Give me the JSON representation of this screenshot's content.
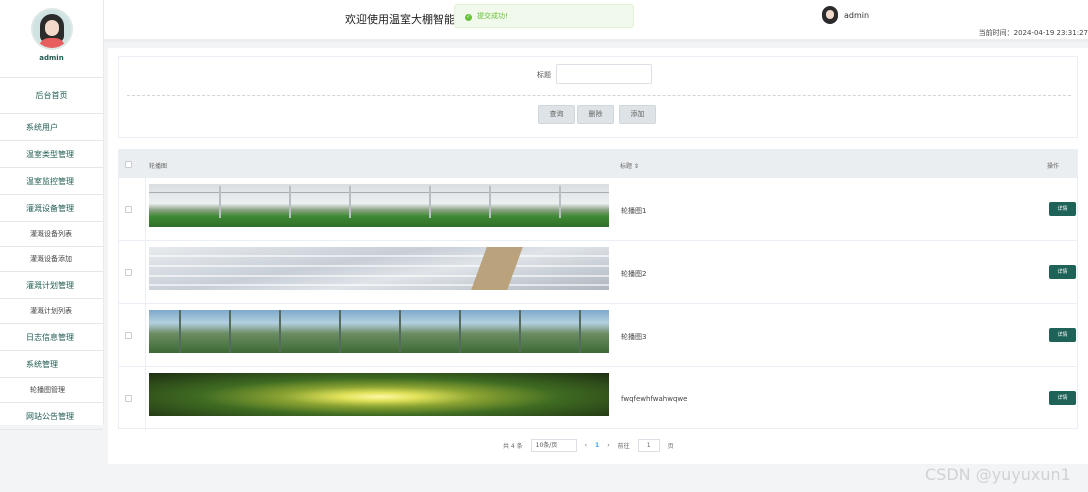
{
  "sidebar": {
    "user_name": "admin",
    "menu": [
      {
        "label": "后台首页",
        "type": "main"
      },
      {
        "label": "系统用户",
        "type": "group"
      },
      {
        "label": "温室类型管理",
        "type": "group"
      },
      {
        "label": "温室监控管理",
        "type": "group"
      },
      {
        "label": "灌溉设备管理",
        "type": "group"
      },
      {
        "label": "灌溉设备列表",
        "type": "sub"
      },
      {
        "label": "灌溉设备添加",
        "type": "sub"
      },
      {
        "label": "灌溉计划管理",
        "type": "group"
      },
      {
        "label": "灌溉计划列表",
        "type": "sub"
      },
      {
        "label": "日志信息管理",
        "type": "group"
      },
      {
        "label": "系统管理",
        "type": "group"
      },
      {
        "label": "轮播图管理",
        "type": "sub"
      },
      {
        "label": "网站公告管理",
        "type": "group"
      }
    ]
  },
  "header": {
    "welcome": "欢迎使用温室大棚智能灌",
    "toast": "提交成功!",
    "user_name": "admin",
    "time": "当前时间：2024-04-19 23:31:27"
  },
  "search": {
    "label": "标题",
    "value": "",
    "buttons": [
      "查询",
      "删除",
      "添加"
    ]
  },
  "table": {
    "headers": {
      "image": "轮播图",
      "title": "标题 ⇕",
      "operation": "操作"
    },
    "rows": [
      {
        "title": "轮播图1",
        "action": "详情"
      },
      {
        "title": "轮播图2",
        "action": "详情"
      },
      {
        "title": "轮播图3",
        "action": "详情"
      },
      {
        "title": "fwqfewhfwahwqwe",
        "action": "详情"
      }
    ]
  },
  "pagination": {
    "total": "共 4 条",
    "page_size": "10条/页",
    "prev": "‹",
    "current": "1",
    "next": "›",
    "goto_label": "前往",
    "goto_value": "1",
    "goto_unit": "页"
  },
  "watermark": "CSDN @yuyuxun1"
}
